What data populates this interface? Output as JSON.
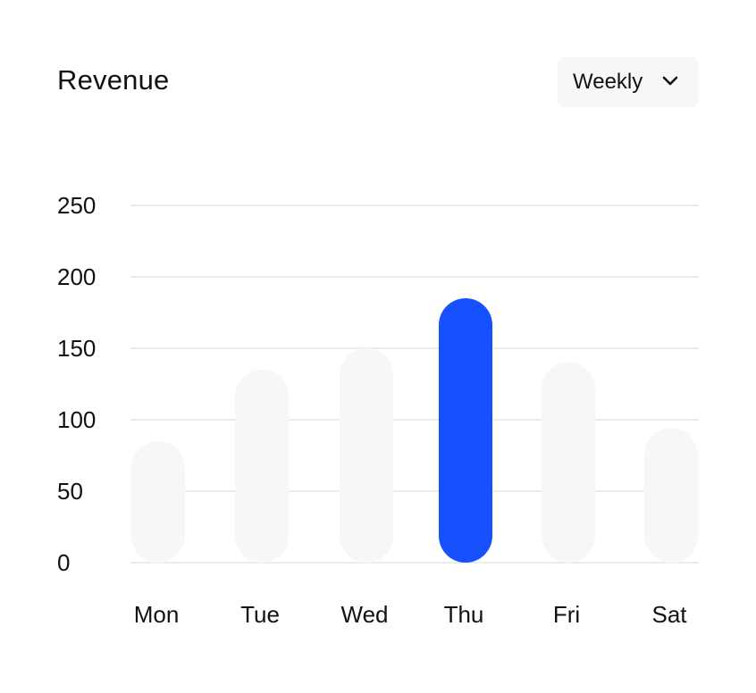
{
  "header": {
    "title": "Revenue",
    "period_select": {
      "selected": "Weekly",
      "icon": "chevron-down-icon"
    }
  },
  "colors": {
    "bar_default": "#f7f7f9",
    "bar_highlight": "#1750ff",
    "gridline": "#ececec"
  },
  "chart_data": {
    "type": "bar",
    "categories": [
      "Mon",
      "Tue",
      "Wed",
      "Thu",
      "Fri",
      "Sat"
    ],
    "values": [
      85,
      135,
      150,
      185,
      140,
      94
    ],
    "highlight_index": 3,
    "y_ticks": [
      "0",
      "50",
      "100",
      "150",
      "200",
      "250"
    ],
    "ylim": [
      0,
      250
    ],
    "grid": true,
    "xlabel": "",
    "ylabel": ""
  }
}
